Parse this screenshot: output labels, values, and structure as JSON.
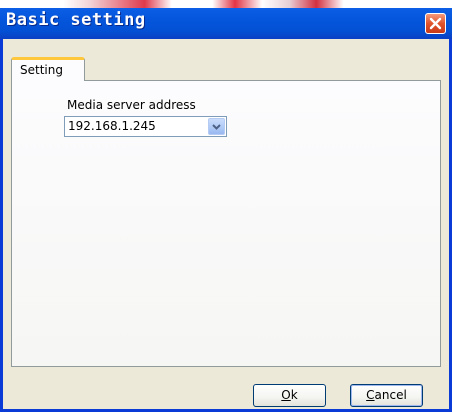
{
  "window": {
    "title": "Basic setting",
    "close_icon": "close-icon"
  },
  "tabs": [
    {
      "label": "Setting",
      "selected": true
    }
  ],
  "settings": {
    "media_server_label": "Media server address",
    "media_server_value": "192.168.1.245",
    "dropdown_icon": "chevron-down-icon"
  },
  "buttons": {
    "ok": {
      "mnemonic": "O",
      "rest": "k"
    },
    "cancel": {
      "mnemonic": "C",
      "rest": "ancel"
    }
  },
  "colors": {
    "titlebar": "#0556dc",
    "close_button": "#e0542c",
    "tab_highlight": "#ffc83c",
    "button_border": "#003c74"
  }
}
